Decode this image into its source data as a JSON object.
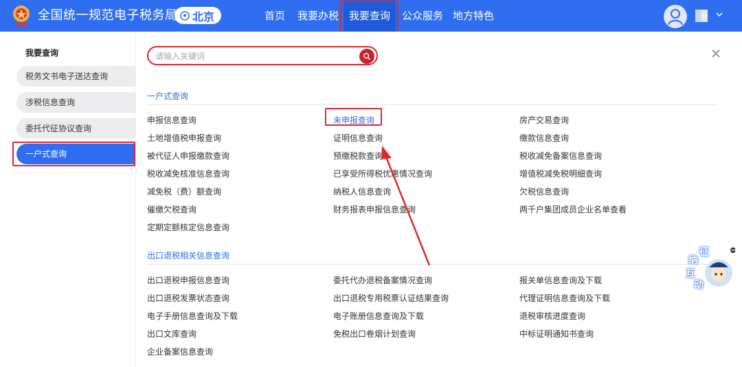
{
  "header": {
    "site_title": "全国统一规范电子税务局",
    "city": "北京",
    "nav": [
      "首页",
      "我要办税",
      "我要查询",
      "公众服务",
      "地方特色"
    ],
    "active_nav": "我要查询"
  },
  "sidebar": {
    "title": "我要查询",
    "items": [
      {
        "label": "税务文书电子送达查询"
      },
      {
        "label": "涉税信息查询"
      },
      {
        "label": "委托代征协议查询"
      },
      {
        "label": "一户式查询"
      }
    ],
    "active_index": 3
  },
  "search": {
    "placeholder": "请输入关键词"
  },
  "sections": [
    {
      "title": "一户式查询",
      "columns": [
        [
          "申报信息查询",
          "土地增值税申报查询",
          "被代征人申报缴款查询",
          "税收减免核准信息查询",
          "减免税（费）额查询",
          "催缴欠税查询",
          "定期定额核定信息查询"
        ],
        [
          "未申报查询",
          "证明信息查询",
          "预缴税款查询",
          "已享受所得税优惠情况查询",
          "纳税人信息查询",
          "财务报表申报信息查询"
        ],
        [
          "房产交易查询",
          "缴款信息查询",
          "税收减免备案信息查询",
          "增值税减免税明细查询",
          "欠税信息查询",
          "两千户集团成员企业名单查看"
        ]
      ]
    },
    {
      "title": "出口退税相关信息查询",
      "columns": [
        [
          "出口退税申报信息查询",
          "出口退税发票状态查询",
          "电子手册信息查询及下载",
          "出口文库查询",
          "企业备案信息查询"
        ],
        [
          "委托代办退税备案情况查询",
          "出口退税专用税票认证结果查询",
          "电子账册信息查询及下载",
          "免税出口卷烟计划查询"
        ],
        [
          "报关单信息查询及下载",
          "代理证明信息查询及下载",
          "退税审核进度查询",
          "中标证明通知书查询"
        ]
      ]
    }
  ],
  "widget": {
    "chars": [
      "征",
      "纳",
      "互",
      "动"
    ]
  },
  "colors": {
    "brand_blue": "#2f6ef0",
    "highlight_red": "#e0262d"
  }
}
